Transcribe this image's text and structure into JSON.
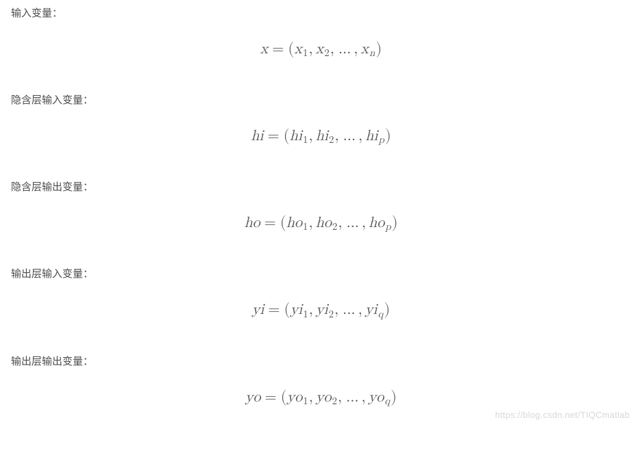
{
  "sections": [
    {
      "label": "输入变量：",
      "formula": {
        "lhs_var": "x",
        "rhs_prefix": "x",
        "index_last": "n"
      }
    },
    {
      "label": "隐含层输入变量：",
      "formula": {
        "lhs_var": "hi",
        "rhs_prefix": "hi",
        "index_last": "p"
      }
    },
    {
      "label": "隐含层输出变量：",
      "formula": {
        "lhs_var": "ho",
        "rhs_prefix": "ho",
        "index_last": "p"
      }
    },
    {
      "label": "输出层输入变量：",
      "formula": {
        "lhs_var": "yi",
        "rhs_prefix": "yi",
        "index_last": "q"
      }
    },
    {
      "label": "输出层输出变量：",
      "formula": {
        "lhs_var": "yo",
        "rhs_prefix": "yo",
        "index_last": "q"
      }
    }
  ],
  "idx1": "1",
  "idx2": "2",
  "eq": "=",
  "lparen": "(",
  "rparen": ")",
  "comma": ",",
  "ellipsis": "…",
  "watermark": "https://blog.csdn.net/TIQCmatlab"
}
